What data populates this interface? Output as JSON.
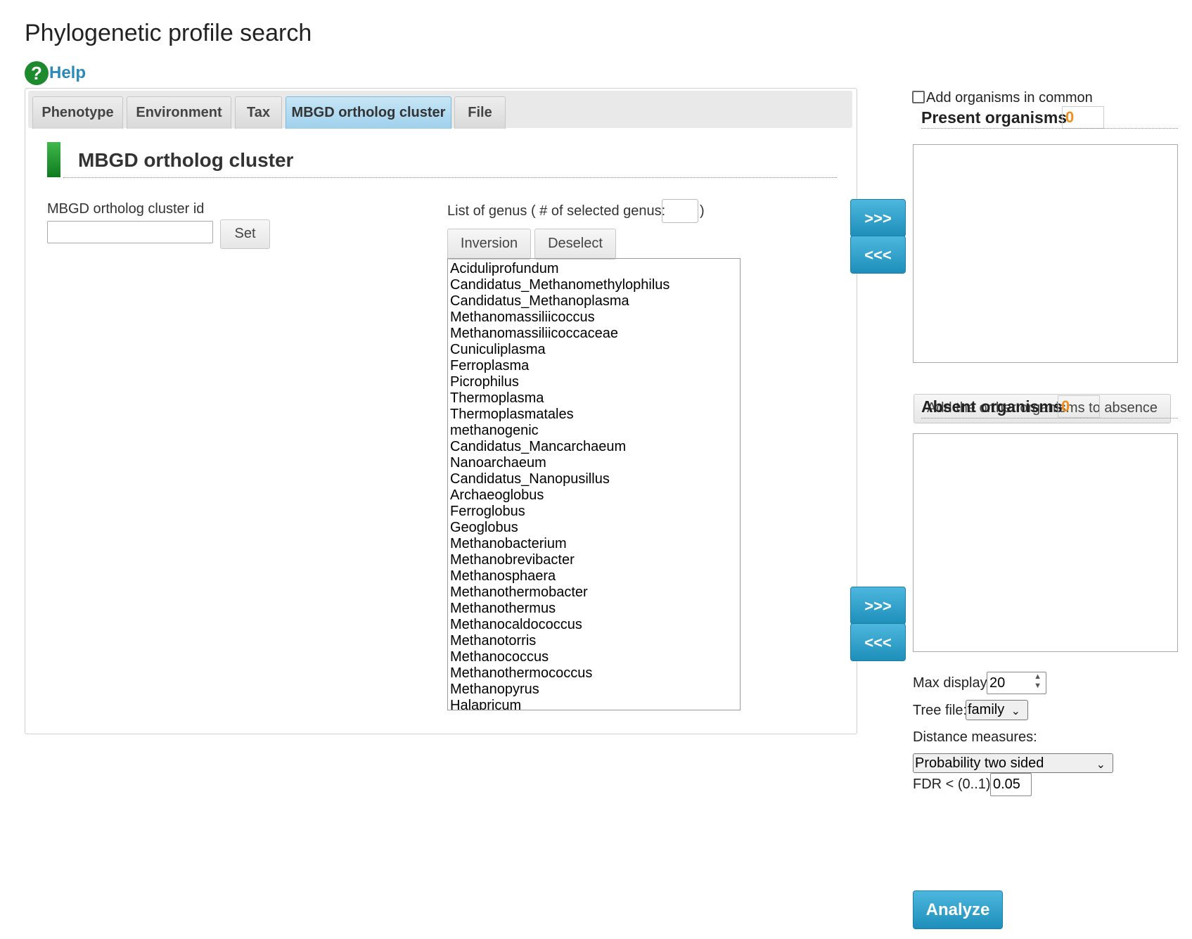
{
  "page": {
    "title": "Phylogenetic profile search",
    "help_label": "Help"
  },
  "tabs": [
    {
      "label": "Phenotype"
    },
    {
      "label": "Environment"
    },
    {
      "label": "Tax"
    },
    {
      "label": "MBGD ortholog cluster",
      "active": true
    },
    {
      "label": "File"
    }
  ],
  "section": {
    "title": "MBGD ortholog cluster",
    "cluster_id_label": "MBGD ortholog cluster id",
    "cluster_id_value": "",
    "set_label": "Set"
  },
  "genus": {
    "label": "List of genus ( # of selected genus:",
    "label_close": ")",
    "selected_count": "",
    "inversion_label": "Inversion",
    "deselect_label": "Deselect",
    "items": [
      "Aciduliprofundum",
      "Candidatus_Methanomethylophilus",
      "Candidatus_Methanoplasma",
      "Methanomassiliicoccus",
      "Methanomassiliicoccaceae",
      "Cuniculiplasma",
      "Ferroplasma",
      "Picrophilus",
      "Thermoplasma",
      "Thermoplasmatales",
      "methanogenic",
      "Candidatus_Mancarchaeum",
      "Nanoarchaeum",
      "Candidatus_Nanopusillus",
      "Archaeoglobus",
      "Ferroglobus",
      "Geoglobus",
      "Methanobacterium",
      "Methanobrevibacter",
      "Methanosphaera",
      "Methanothermobacter",
      "Methanothermus",
      "Methanocaldococcus",
      "Methanotorris",
      "Methanococcus",
      "Methanothermococcus",
      "Methanopyrus",
      "Halapricum"
    ]
  },
  "arrows": {
    "add": ">>>",
    "remove": "<<<"
  },
  "organisms": {
    "common_label": "Add organisms in common",
    "common_checked": false,
    "present_title": "Present organisms",
    "present_count": "0",
    "add_other_label": "Add the orther organisms to absence",
    "absent_title": "Absent organisms",
    "absent_count": "0"
  },
  "options": {
    "max_display_label": "Max display:",
    "max_display_value": "20",
    "tree_file_label": "Tree file:",
    "tree_file_value": "family",
    "distance_label": "Distance measures:",
    "distance_value": "Probability two sided",
    "fdr_label": "FDR < (0..1):",
    "fdr_value": "0.05",
    "analyze_label": "Analyze"
  },
  "colors": {
    "accent_blue": "#2a9bc7",
    "count_orange": "#f18f1c",
    "section_green": "#1e8a2e"
  }
}
